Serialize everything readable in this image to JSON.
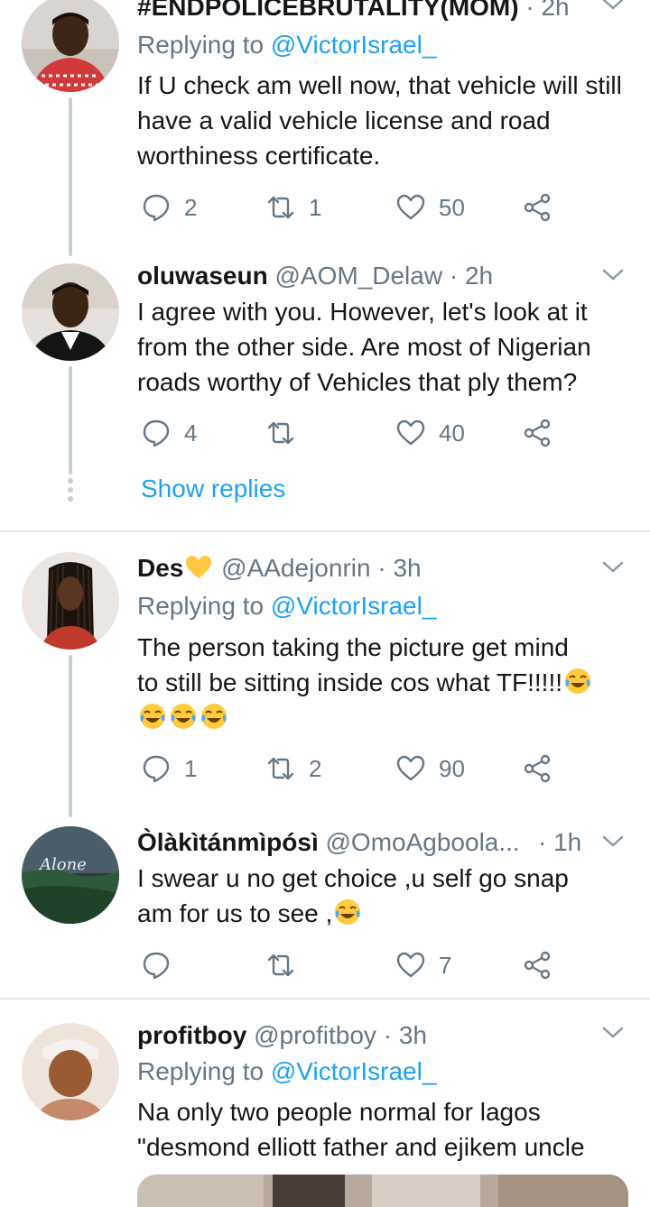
{
  "tweets": [
    {
      "name": "#ENDPOLICEBRUTALITY(MOM)",
      "handle": "",
      "time": "2h",
      "replying_label": "Replying to ",
      "replying_to": "@VictorIsrael_",
      "text": "If U check am well now, that vehicle will still have a valid vehicle license and road worthiness certificate.",
      "replies": "2",
      "retweets": "1",
      "likes": "50"
    },
    {
      "name": "oluwaseun",
      "handle": "@AOM_Delaw",
      "time": "2h",
      "text": "I agree with you. However, let's look at it from the other side. Are most of Nigerian roads worthy of Vehicles that ply them?",
      "replies": "4",
      "retweets": "",
      "likes": "40"
    },
    {
      "name": "Des",
      "handle": "@AAdejonrin",
      "time": "3h",
      "replying_label": "Replying to ",
      "replying_to": "@VictorIsrael_",
      "text_line1": "The person taking the picture get mind",
      "text_line2": "to still be sitting inside cos what TF!!!!!",
      "replies": "1",
      "retweets": "2",
      "likes": "90"
    },
    {
      "name": "Òlàkìtánmìpósì",
      "handle": "@OmoAgboola...",
      "time": "1h",
      "text_line1": "I swear u no get choice ,u self go snap",
      "text_line2": "am for us to see ,",
      "replies": "",
      "retweets": "",
      "likes": "7"
    },
    {
      "name": "profitboy",
      "handle": "@profitboy",
      "time": "3h",
      "replying_label": "Replying to ",
      "replying_to": "@VictorIsrael_",
      "text": "Na only two people normal for lagos \"desmond elliott father  and ejikem uncle"
    }
  ],
  "show_replies": "Show replies",
  "separator": "·",
  "avatar_art_text": "Alone",
  "colors": {
    "accent": "#1da1f2",
    "secondary_text": "#657786",
    "heart_emoji": "#ffc83d",
    "icon": "#657786"
  },
  "icons": [
    "reply-icon",
    "retweet-icon",
    "like-icon",
    "share-icon",
    "caret-down-icon",
    "yellow-heart-emoji",
    "tears-of-joy-emoji"
  ]
}
